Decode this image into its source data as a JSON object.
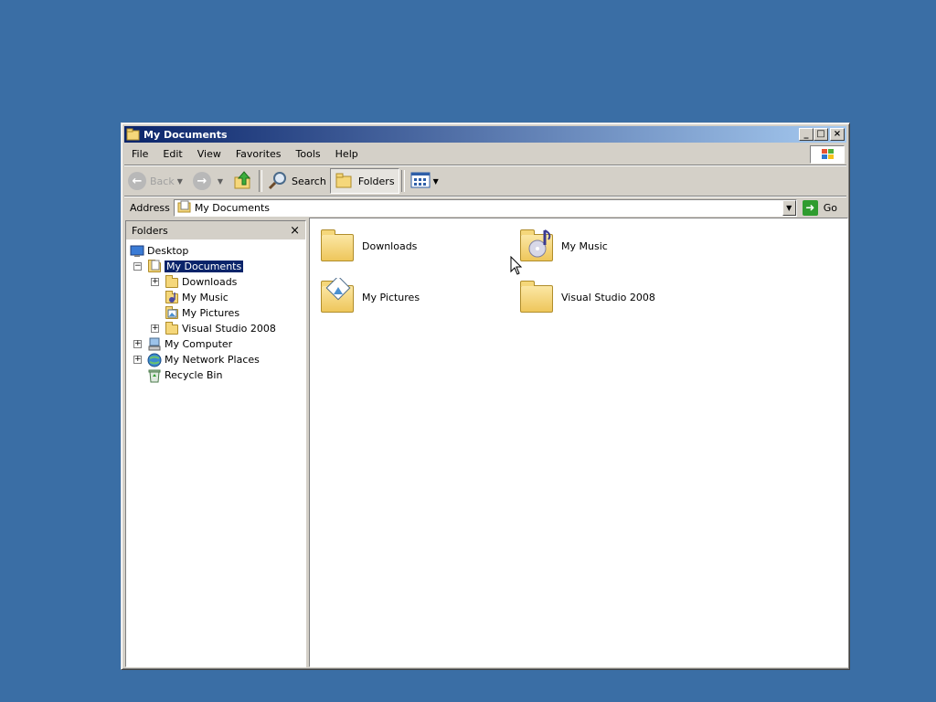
{
  "window": {
    "title": "My Documents",
    "controls": {
      "minimize": "_",
      "maximize": "□",
      "close": "×"
    }
  },
  "menubar": [
    "File",
    "Edit",
    "View",
    "Favorites",
    "Tools",
    "Help"
  ],
  "toolbar": {
    "back_label": "Back",
    "search_label": "Search",
    "folders_label": "Folders"
  },
  "address": {
    "label": "Address",
    "value": "My Documents",
    "go_label": "Go"
  },
  "folders_pane": {
    "title": "Folders",
    "close": "×",
    "tree": [
      {
        "label": "Desktop",
        "icon": "desktop-icon",
        "expander": ""
      },
      {
        "label": "My Documents",
        "icon": "my-documents-icon",
        "expander": "−",
        "selected": true
      },
      {
        "label": "Downloads",
        "icon": "folder-icon",
        "expander": "+"
      },
      {
        "label": "My Music",
        "icon": "music-folder-icon",
        "expander": ""
      },
      {
        "label": "My Pictures",
        "icon": "pictures-folder-icon",
        "expander": ""
      },
      {
        "label": "Visual Studio 2008",
        "icon": "folder-icon",
        "expander": "+"
      },
      {
        "label": "My Computer",
        "icon": "computer-icon",
        "expander": "+"
      },
      {
        "label": "My Network Places",
        "icon": "network-icon",
        "expander": "+"
      },
      {
        "label": "Recycle Bin",
        "icon": "recycle-bin-icon",
        "expander": ""
      }
    ]
  },
  "content": {
    "items": [
      {
        "label": "Downloads",
        "icon": "folder-icon"
      },
      {
        "label": "My Music",
        "icon": "music-folder-icon"
      },
      {
        "label": "My Pictures",
        "icon": "pictures-folder-icon"
      },
      {
        "label": "Visual Studio 2008",
        "icon": "folder-icon"
      }
    ]
  },
  "colors": {
    "desktop": "#3a6ea5",
    "titlebar_start": "#0a246a",
    "titlebar_end": "#a6caf0",
    "selection": "#0a246a"
  }
}
